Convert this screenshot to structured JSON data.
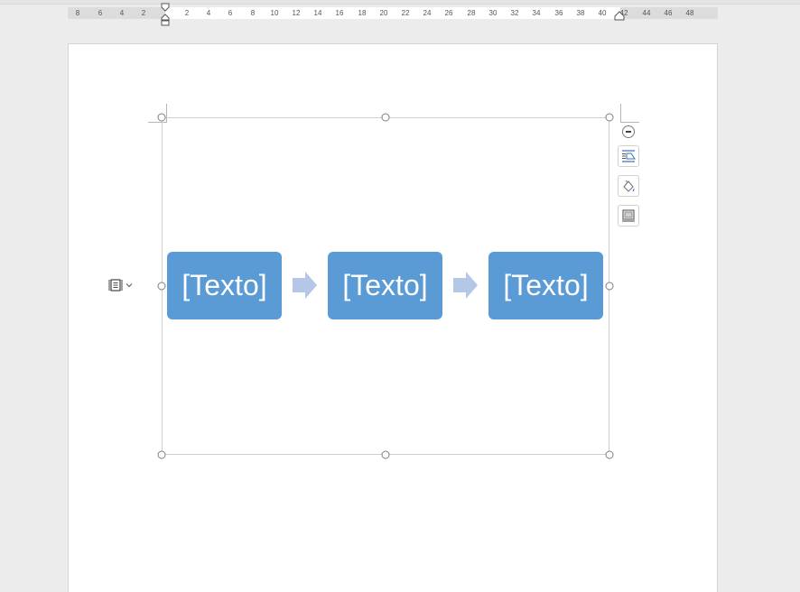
{
  "ruler": {
    "ticks": [
      "8",
      "6",
      "4",
      "2",
      "2",
      "4",
      "6",
      "8",
      "10",
      "12",
      "14",
      "16",
      "18",
      "20",
      "22",
      "24",
      "26",
      "28",
      "30",
      "32",
      "34",
      "36",
      "38",
      "40",
      "42",
      "44",
      "46",
      "48"
    ]
  },
  "smartart": {
    "boxes": [
      {
        "label": "[Texto]"
      },
      {
        "label": "[Texto]"
      },
      {
        "label": "[Texto]"
      }
    ]
  },
  "colors": {
    "box_fill": "#5b9bd5",
    "arrow_fill": "#b4c7e7",
    "page": "#ffffff",
    "workspace": "#ececec"
  },
  "icons": {
    "layout_options": "layout-options-icon",
    "styles": "smartart-styles-icon",
    "filter": "filter-icon",
    "collapse": "collapse-icon",
    "text_pane": "text-pane-icon"
  }
}
